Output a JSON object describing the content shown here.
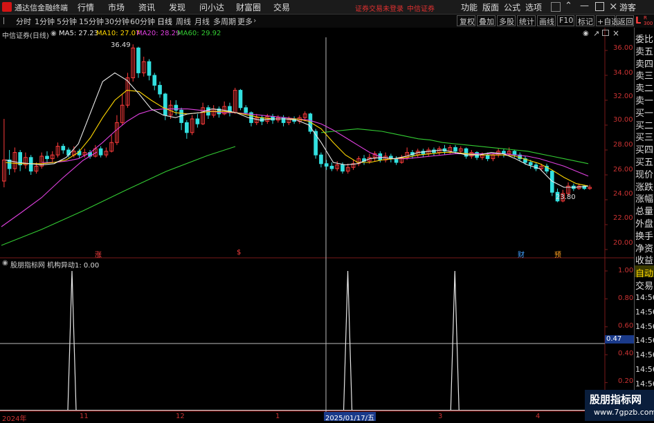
{
  "topbar": {
    "app_title": "通达信金融终端",
    "menus": [
      "行情",
      "市场",
      "资讯",
      "发现",
      "问小达",
      "财富圈",
      "交易"
    ],
    "notice": "证券交易未登录",
    "broker": "中信证券",
    "right_menus": [
      "功能",
      "版面",
      "公式",
      "选项"
    ],
    "guest": "游客"
  },
  "periodbar": {
    "periods": [
      "分时",
      "1分钟",
      "5分钟",
      "15分钟",
      "30分钟",
      "60分钟",
      "日线",
      "周线",
      "月线",
      "多周期",
      "更多"
    ],
    "active": "日线",
    "tools": [
      "复权",
      "叠加",
      "多股",
      "统计",
      "画线",
      "F10",
      "标记",
      "+自选",
      "返回"
    ]
  },
  "main_chart": {
    "stock_label": "中信证券(日线)",
    "ma_legend": [
      {
        "label": "MA5: 27.23",
        "color": "#e8e8e8"
      },
      {
        "label": "MA10: 27.07",
        "color": "#ffd700"
      },
      {
        "label": "MA20: 28.29",
        "color": "#e040e0"
      },
      {
        "label": "MA60: 29.92",
        "color": "#33cc33"
      }
    ],
    "high_label": "36.49",
    "low_label": "23.80",
    "y_ticks": [
      "36.00",
      "34.00",
      "32.00",
      "30.00",
      "28.00",
      "26.00",
      "24.00",
      "22.00",
      "20.00"
    ],
    "markers": [
      {
        "text": "涨",
        "color": "#ff4040"
      },
      {
        "text": "$",
        "color": "#ff4040"
      },
      {
        "text": "财",
        "color": "#40a0ff"
      },
      {
        "text": "预",
        "color": "#ffa020"
      }
    ],
    "colors": {
      "up": "#ff3c3c",
      "down": "#33e0e0",
      "ma5": "#e8e8e8",
      "ma10": "#ffd700",
      "ma20": "#e040e0",
      "ma60": "#33cc33"
    }
  },
  "sub_chart": {
    "indicator_label": "股朋指标网",
    "formula_label": "机构异动1: 0.00",
    "y_ticks": [
      "1.00",
      "0.80",
      "0.60",
      "0.40",
      "0.20"
    ],
    "crosshair_value": "0.47"
  },
  "x_axis": {
    "labels": [
      "2024年",
      "11",
      "12",
      "1",
      "2025/01/17/五",
      "3",
      "4"
    ]
  },
  "right_panel": {
    "corner": "L",
    "corner_small": "R 300",
    "items": [
      "委比",
      "卖五",
      "卖四",
      "卖三",
      "卖二",
      "卖一",
      "买一",
      "买二",
      "买三",
      "买四",
      "买五",
      "现价",
      "涨跌",
      "涨幅",
      "总量",
      "外盘",
      "换手",
      "净资",
      "收益"
    ],
    "auto_label": "自动",
    "trade_label": "交易",
    "times": [
      "14:56",
      "14:56",
      "14:56",
      "14:56",
      "14:56",
      "14:56",
      "14:56",
      "14:56",
      "14:56"
    ]
  },
  "watermark": {
    "line1": "股朋指标网",
    "line2": "www.7gpzb.com"
  },
  "chart_data": {
    "type": "candlestick",
    "title": "中信证券(日线)",
    "ylim": [
      19.5,
      37.0
    ],
    "candles": [
      [
        25.5,
        27.2,
        25.0,
        30.5
      ],
      [
        27.2,
        26.5,
        26.0,
        28.0
      ],
      [
        26.5,
        27.8,
        26.2,
        28.2
      ],
      [
        27.8,
        26.8,
        26.3,
        28.0
      ],
      [
        26.8,
        27.4,
        26.5,
        27.8
      ],
      [
        27.4,
        26.3,
        26.0,
        27.6
      ],
      [
        26.3,
        26.7,
        26.1,
        27.0
      ],
      [
        26.7,
        27.5,
        26.5,
        27.8
      ],
      [
        27.5,
        27.3,
        27.0,
        27.9
      ],
      [
        27.3,
        27.6,
        27.0,
        27.9
      ],
      [
        27.6,
        28.3,
        27.4,
        28.6
      ],
      [
        28.3,
        28.0,
        27.7,
        28.5
      ],
      [
        28.0,
        27.6,
        27.4,
        28.2
      ],
      [
        27.6,
        27.9,
        27.4,
        28.3
      ],
      [
        27.9,
        27.6,
        27.3,
        28.1
      ],
      [
        27.6,
        27.8,
        27.4,
        28.1
      ],
      [
        27.8,
        27.5,
        27.3,
        28.0
      ],
      [
        27.5,
        28.1,
        27.4,
        28.4
      ],
      [
        28.1,
        27.6,
        27.4,
        28.3
      ],
      [
        27.6,
        27.9,
        27.4,
        28.2
      ],
      [
        27.9,
        28.6,
        27.8,
        29.2
      ],
      [
        28.6,
        30.2,
        28.4,
        30.8
      ],
      [
        30.2,
        31.6,
        30.0,
        32.5
      ],
      [
        31.6,
        33.8,
        31.4,
        34.2
      ],
      [
        33.8,
        36.2,
        33.5,
        36.49
      ],
      [
        36.2,
        34.2,
        33.8,
        36.3
      ],
      [
        34.2,
        35.1,
        33.9,
        35.5
      ],
      [
        35.1,
        34.0,
        33.6,
        35.3
      ],
      [
        34.0,
        33.2,
        32.8,
        34.2
      ],
      [
        33.2,
        32.5,
        32.2,
        33.5
      ],
      [
        32.5,
        30.8,
        30.4,
        32.6
      ],
      [
        30.8,
        31.6,
        30.5,
        32.0
      ],
      [
        31.6,
        31.2,
        30.8,
        32.0
      ],
      [
        31.2,
        30.2,
        29.6,
        31.4
      ],
      [
        30.2,
        29.4,
        28.9,
        30.4
      ],
      [
        29.4,
        30.5,
        29.2,
        30.8
      ],
      [
        30.5,
        30.1,
        29.8,
        30.9
      ],
      [
        30.1,
        31.4,
        30.0,
        31.8
      ],
      [
        31.4,
        30.8,
        30.5,
        31.6
      ],
      [
        30.8,
        31.3,
        30.6,
        31.6
      ],
      [
        31.3,
        30.9,
        30.6,
        31.5
      ],
      [
        30.9,
        31.5,
        30.8,
        31.9
      ],
      [
        31.5,
        31.0,
        30.7,
        31.8
      ],
      [
        31.0,
        32.8,
        30.9,
        33.0
      ],
      [
        32.8,
        31.4,
        31.2,
        32.9
      ],
      [
        31.4,
        31.0,
        30.8,
        31.6
      ],
      [
        31.0,
        30.2,
        29.9,
        31.1
      ],
      [
        30.2,
        30.6,
        30.0,
        30.9
      ],
      [
        30.6,
        30.3,
        30.0,
        30.8
      ],
      [
        30.3,
        30.7,
        30.1,
        30.9
      ],
      [
        30.7,
        30.4,
        30.1,
        30.9
      ],
      [
        30.4,
        30.6,
        30.2,
        30.8
      ],
      [
        30.6,
        30.2,
        29.9,
        30.8
      ],
      [
        30.2,
        30.5,
        30.0,
        30.7
      ],
      [
        30.5,
        30.3,
        30.1,
        30.7
      ],
      [
        30.3,
        30.6,
        30.1,
        30.8
      ],
      [
        30.6,
        30.9,
        30.3,
        31.1
      ],
      [
        30.9,
        29.5,
        29.3,
        31.0
      ],
      [
        29.5,
        27.6,
        27.3,
        29.7
      ],
      [
        27.6,
        26.9,
        26.6,
        27.8
      ],
      [
        26.9,
        26.7,
        26.4,
        27.2
      ],
      [
        26.7,
        26.5,
        26.3,
        27.0
      ],
      [
        26.5,
        26.8,
        26.3,
        27.1
      ],
      [
        26.8,
        26.3,
        26.1,
        27.0
      ],
      [
        26.3,
        26.6,
        26.1,
        26.9
      ],
      [
        26.6,
        26.9,
        26.4,
        27.2
      ],
      [
        26.9,
        27.3,
        26.7,
        27.5
      ],
      [
        27.3,
        27.1,
        26.8,
        27.6
      ],
      [
        27.1,
        27.4,
        26.9,
        27.7
      ],
      [
        27.4,
        27.7,
        27.1,
        27.9
      ],
      [
        27.7,
        27.2,
        27.0,
        27.9
      ],
      [
        27.2,
        27.5,
        27.0,
        27.8
      ],
      [
        27.5,
        27.3,
        27.0,
        27.7
      ],
      [
        27.3,
        27.0,
        26.8,
        27.5
      ],
      [
        27.0,
        27.4,
        26.9,
        27.6
      ],
      [
        27.4,
        27.8,
        27.2,
        28.2
      ],
      [
        27.8,
        27.6,
        27.3,
        28.0
      ],
      [
        27.6,
        27.9,
        27.4,
        28.1
      ],
      [
        27.9,
        27.7,
        27.4,
        28.1
      ],
      [
        27.7,
        28.0,
        27.5,
        28.2
      ],
      [
        28.0,
        27.8,
        27.5,
        28.2
      ],
      [
        27.8,
        28.1,
        27.6,
        28.3
      ],
      [
        28.1,
        27.9,
        27.6,
        28.4
      ],
      [
        27.9,
        28.2,
        27.7,
        28.4
      ],
      [
        28.2,
        27.9,
        27.7,
        28.4
      ],
      [
        27.9,
        28.1,
        27.7,
        28.3
      ],
      [
        28.1,
        27.5,
        27.3,
        28.2
      ],
      [
        27.5,
        27.8,
        27.3,
        28.0
      ],
      [
        27.8,
        27.4,
        27.2,
        27.9
      ],
      [
        27.4,
        27.6,
        27.2,
        27.8
      ],
      [
        27.6,
        27.3,
        27.1,
        27.8
      ],
      [
        27.3,
        27.6,
        27.1,
        27.8
      ],
      [
        27.6,
        27.9,
        27.4,
        28.1
      ],
      [
        27.9,
        27.7,
        27.4,
        28.1
      ],
      [
        27.7,
        27.9,
        27.5,
        28.2
      ],
      [
        27.9,
        27.6,
        27.4,
        28.0
      ],
      [
        27.6,
        27.3,
        27.1,
        27.8
      ],
      [
        27.3,
        27.0,
        26.8,
        27.5
      ],
      [
        27.0,
        26.8,
        26.5,
        27.2
      ],
      [
        26.8,
        26.5,
        26.3,
        27.0
      ],
      [
        26.5,
        26.7,
        26.3,
        26.9
      ],
      [
        26.7,
        26.3,
        26.1,
        26.9
      ],
      [
        26.3,
        24.6,
        24.3,
        26.4
      ],
      [
        24.6,
        23.9,
        23.8,
        24.9
      ],
      [
        23.9,
        24.5,
        23.8,
        24.8
      ],
      [
        24.5,
        25.1,
        24.3,
        25.4
      ],
      [
        25.1,
        24.9,
        24.7,
        25.3
      ],
      [
        24.9,
        25.1,
        24.8,
        25.3
      ],
      [
        25.1,
        24.9,
        24.8,
        25.2
      ],
      [
        24.9,
        25.0,
        24.8,
        25.2
      ]
    ],
    "ma_lines": {
      "ma5": [
        27.2,
        27.0,
        26.9,
        26.8,
        26.9,
        27.4,
        28.5,
        31.0,
        33.5,
        34.2,
        33.6,
        32.5,
        31.3,
        30.8,
        30.6,
        30.9,
        31.0,
        31.3,
        31.2,
        31.0,
        30.6,
        30.4,
        30.5,
        30.5,
        30.4,
        30.0,
        28.6,
        27.0,
        26.8,
        26.9,
        27.3,
        27.4,
        27.3,
        27.5,
        27.8,
        27.9,
        28.0,
        27.8,
        27.6,
        27.6,
        27.8,
        27.7,
        27.3,
        26.8,
        26.5,
        25.5,
        25.0,
        25.0,
        25.1
      ],
      "ma10": [
        27.0,
        26.9,
        26.9,
        26.9,
        27.0,
        27.2,
        27.8,
        29.0,
        30.6,
        32.0,
        32.8,
        32.7,
        32.0,
        31.4,
        31.0,
        30.9,
        31.0,
        31.1,
        31.1,
        31.0,
        30.8,
        30.6,
        30.5,
        30.5,
        30.5,
        30.3,
        29.7,
        28.6,
        27.6,
        27.0,
        27.0,
        27.2,
        27.3,
        27.4,
        27.6,
        27.7,
        27.8,
        27.8,
        27.7,
        27.6,
        27.6,
        27.6,
        27.5,
        27.2,
        26.9,
        26.4,
        25.8,
        25.3,
        25.1
      ],
      "ma20": [
        null,
        null,
        null,
        27.0,
        27.0,
        27.1,
        27.3,
        27.8,
        28.6,
        29.5,
        30.3,
        30.9,
        31.2,
        31.3,
        31.3,
        31.3,
        31.2,
        31.1,
        31.0,
        31.0,
        30.9,
        30.8,
        30.7,
        30.6,
        30.5,
        30.4,
        30.1,
        29.6,
        29.0,
        28.4,
        27.8,
        27.4,
        27.3,
        27.3,
        27.4,
        27.5,
        27.6,
        27.7,
        27.7,
        27.7,
        27.7,
        27.7,
        27.6,
        27.5,
        27.3,
        27.0,
        26.7,
        26.3,
        25.9
      ],
      "ma60": [
        null,
        null,
        null,
        null,
        null,
        null,
        null,
        null,
        null,
        null,
        null,
        null,
        null,
        null,
        null,
        null,
        null,
        null,
        null,
        null,
        null,
        null,
        null,
        null,
        null,
        null,
        29.4,
        29.5,
        29.6,
        29.7,
        29.6,
        29.5,
        29.3,
        29.1,
        28.9,
        28.8,
        28.6,
        28.5,
        28.4,
        28.3,
        28.2,
        28.1,
        28.0,
        27.9,
        27.7,
        27.5,
        27.3,
        27.1,
        26.9
      ]
    },
    "indicator": {
      "name": "机构异动1",
      "ylim": [
        0,
        1.0
      ],
      "spike_positions": [
        0.119,
        0.575,
        0.752
      ],
      "spike_value": 1.0
    }
  }
}
